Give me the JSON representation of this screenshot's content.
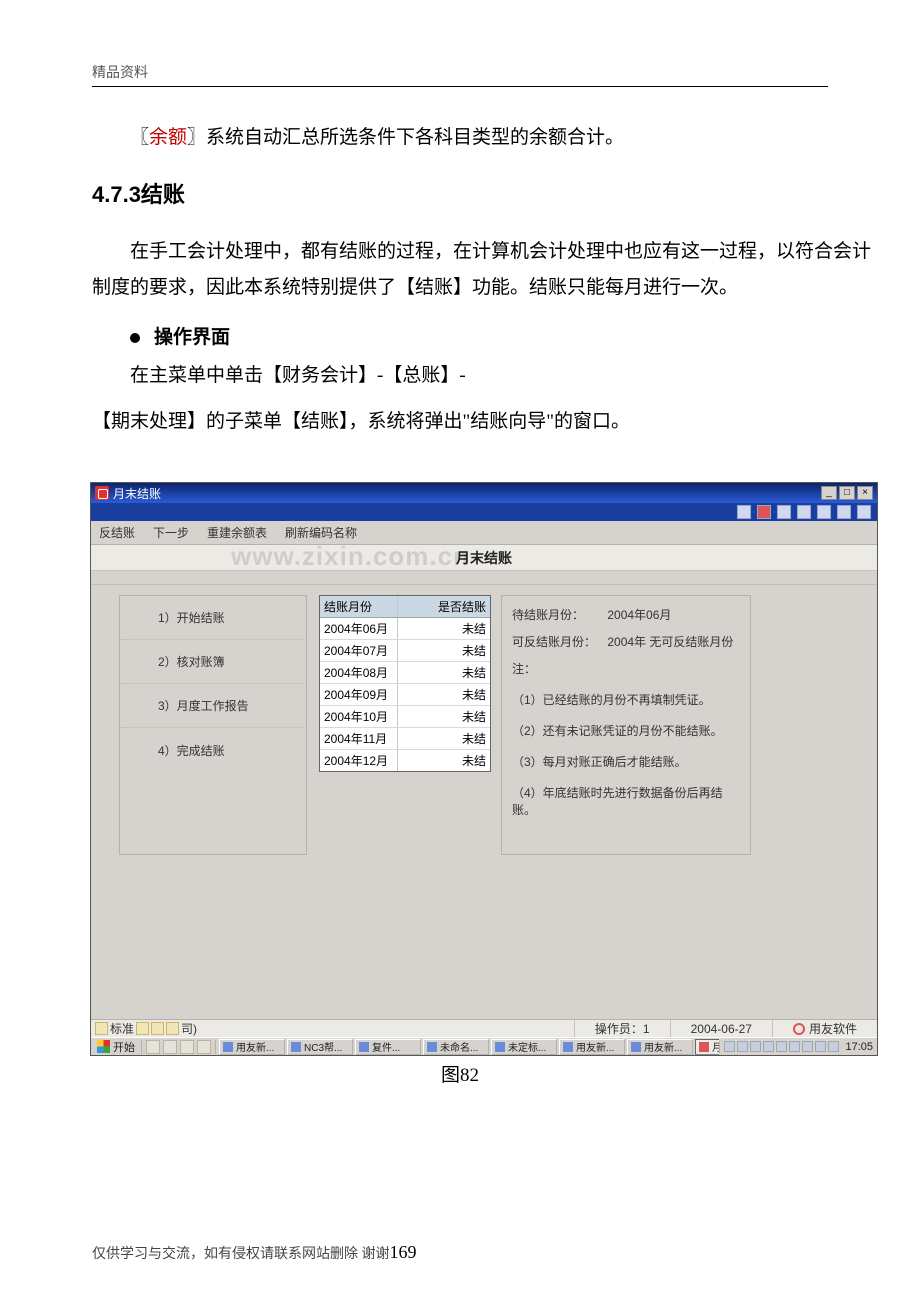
{
  "page_header": "精品资料",
  "para1_pre": "〖",
  "para1_red": "余额",
  "para1_post": "〗系统自动汇总所选条件下各科目类型的余额合计。",
  "heading": "4.7.3结账",
  "para2": "在手工会计处理中，都有结账的过程，在计算机会计处理中也应有这一过程，以符合会计制度的要求，因此本系统特别提供了【结账】功能。结账只能每月进行一次。",
  "bullet": "操作界面",
  "para3": "在主菜单中单击【财务会计】-【总账】-",
  "para4": "【期末处理】的子菜单【结账】，系统将弹出\"结账向导\"的窗口。",
  "caption": "图82",
  "footer_text": "仅供学习与交流，如有侵权请联系网站删除 谢谢",
  "footer_page": "169",
  "window": {
    "title": "月末结账",
    "menu": [
      "反结账",
      "下一步",
      "重建余额表",
      "刷新编码名称"
    ],
    "band_title": "月末结账",
    "watermark": "www.zixin.com.cn",
    "steps": [
      "1）开始结账",
      "2）核对账簿",
      "3）月度工作报告",
      "4）完成结账"
    ],
    "grid": {
      "headers": [
        "结账月份",
        "是否结账"
      ],
      "rows": [
        [
          "2004年06月",
          "未结"
        ],
        [
          "2004年07月",
          "未结"
        ],
        [
          "2004年08月",
          "未结"
        ],
        [
          "2004年09月",
          "未结"
        ],
        [
          "2004年10月",
          "未结"
        ],
        [
          "2004年11月",
          "未结"
        ],
        [
          "2004年12月",
          "未结"
        ]
      ]
    },
    "info": {
      "l1_label": "待结账月份：",
      "l1_value": "2004年06月",
      "l2_label": "可反结账月份：",
      "l2_value": "2004年 无可反结账月份",
      "notes_label": "注：",
      "notes": [
        "（1）已经结账的月份不再填制凭证。",
        "（2）还有未记账凭证的月份不能结账。",
        "（3）每月对账正确后才能结账。",
        "（4）年底结账时先进行数据备份后再结账。"
      ]
    },
    "status": {
      "left": "标准",
      "left_suffix": "司)",
      "operator": "操作员：1",
      "date": "2004-06-27",
      "brand": "用友软件"
    },
    "taskbar": {
      "start": "开始",
      "tasks": [
        "用友新...",
        "NC3帮...",
        "复件...",
        "未命名...",
        "未定标...",
        "用友新...",
        "用友新...",
        "月末结账"
      ],
      "clock": "17:05"
    }
  }
}
